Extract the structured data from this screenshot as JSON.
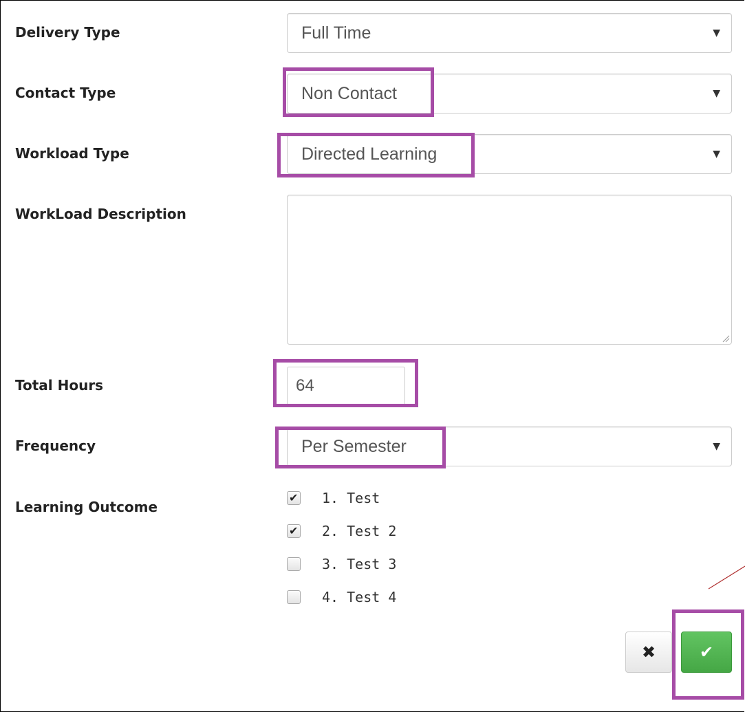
{
  "form": {
    "delivery_type": {
      "label": "Delivery Type",
      "value": "Full Time"
    },
    "contact_type": {
      "label": "Contact Type",
      "value": "Non Contact"
    },
    "workload_type": {
      "label": "Workload Type",
      "value": "Directed Learning"
    },
    "workload_description": {
      "label": "WorkLoad Description",
      "value": ""
    },
    "total_hours": {
      "label": "Total Hours",
      "value": "64"
    },
    "frequency": {
      "label": "Frequency",
      "value": "Per Semester"
    },
    "learning_outcome": {
      "label": "Learning Outcome",
      "options": [
        {
          "label": "1. Test",
          "checked": true
        },
        {
          "label": "2. Test 2",
          "checked": true
        },
        {
          "label": "3. Test 3",
          "checked": false
        },
        {
          "label": "4. Test 4",
          "checked": false
        }
      ]
    }
  },
  "actions": {
    "cancel_icon": "close-icon",
    "confirm_icon": "check-icon"
  },
  "colors": {
    "highlight": "#a64ca6",
    "confirm_button": "#4cb14c",
    "annotation_line": "#b03030"
  }
}
